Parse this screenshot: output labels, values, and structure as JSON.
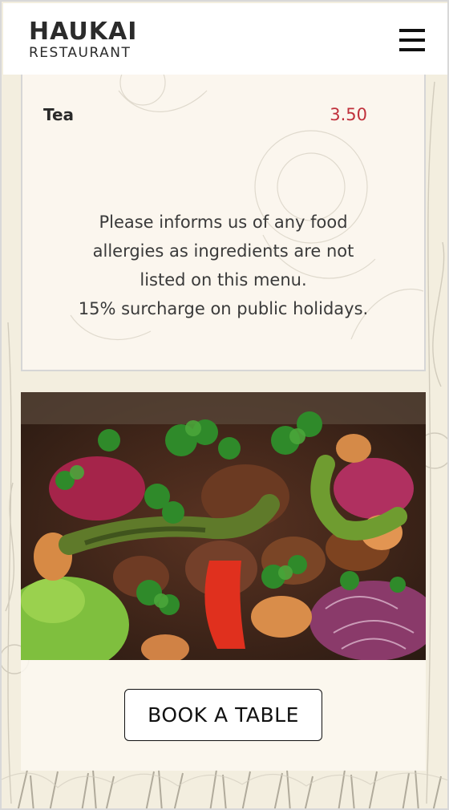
{
  "brand": {
    "name": "HAUKAI",
    "subtitle": "RESTAURANT"
  },
  "nav": {
    "menu_icon": "hamburger-icon"
  },
  "menu_item": {
    "name": "Tea",
    "price": "3.50"
  },
  "notice": {
    "line1": "Please informs us of any food",
    "line2": "allergies as ingredients are not",
    "line3": "listed on this menu.",
    "line4": "15% surcharge on public holidays."
  },
  "cta": {
    "label": "BOOK A TABLE"
  },
  "colors": {
    "price": "#c0303b",
    "background": "#f3eedf",
    "header": "#ffffff"
  }
}
